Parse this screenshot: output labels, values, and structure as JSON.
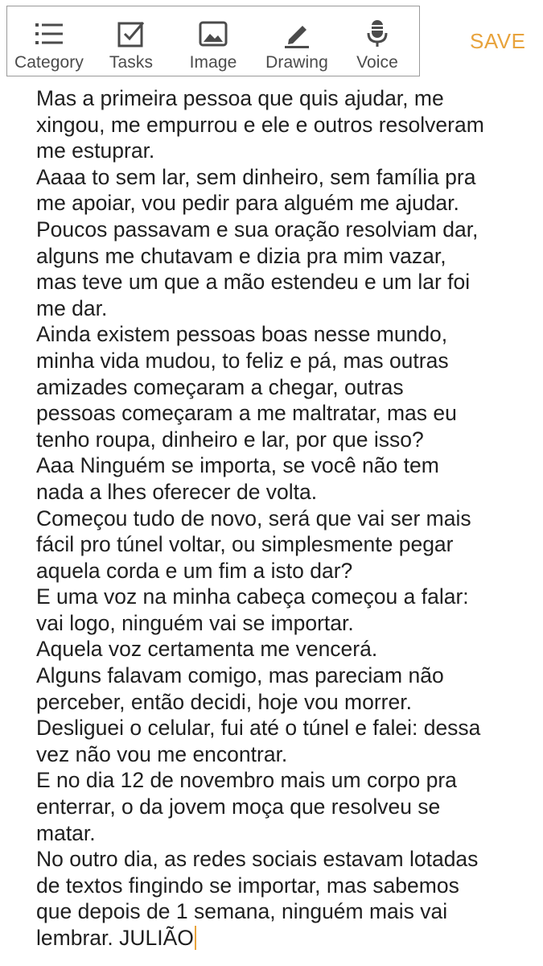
{
  "toolbar": {
    "items": [
      {
        "label": "Category",
        "icon": "list-icon"
      },
      {
        "label": "Tasks",
        "icon": "checkbox-icon"
      },
      {
        "label": "Image",
        "icon": "image-icon"
      },
      {
        "label": "Drawing",
        "icon": "pen-icon"
      },
      {
        "label": "Voice",
        "icon": "microphone-icon"
      }
    ],
    "save_label": "SAVE"
  },
  "colors": {
    "accent": "#e8a33c",
    "icon": "#4b4b4b",
    "text": "#1f1f1f",
    "border": "#9a9a9a"
  },
  "note": {
    "lines": [
      "Mas a primeira pessoa que quis ajudar, me",
      "xingou, me empurrou e ele e outros resolveram",
      "me estuprar.",
      "Aaaa to sem lar, sem dinheiro, sem família pra",
      "me apoiar, vou pedir para alguém me ajudar.",
      "Poucos passavam e sua oração resolviam dar,",
      "alguns me chutavam e dizia pra mim vazar,",
      "mas teve um que a mão estendeu e um lar foi",
      "me dar.",
      "Ainda existem pessoas boas nesse mundo,",
      "minha vida mudou, to feliz e pá, mas outras",
      "amizades começaram a chegar, outras",
      "pessoas começaram a me maltratar, mas eu",
      "tenho roupa, dinheiro e lar, por que isso?",
      "Aaa Ninguém se importa, se você não tem",
      "nada a lhes oferecer de volta.",
      "Começou tudo de novo, será que vai ser mais",
      "fácil pro túnel voltar, ou simplesmente pegar",
      "aquela corda e um fim a isto dar?",
      "E uma voz na minha cabeça começou a falar:",
      "vai logo, ninguém vai se importar.",
      "Aquela voz certamenta me vencerá.",
      "Alguns falavam comigo, mas pareciam não",
      "perceber, então decidi, hoje vou morrer.",
      "Desliguei o celular, fui até o túnel e falei: dessa",
      "vez não vou me encontrar.",
      "E no dia 12 de novembro mais um corpo pra",
      "enterrar, o da jovem moça que resolveu se",
      "matar.",
      "No outro dia, as redes sociais estavam lotadas",
      "de textos fingindo se importar, mas sabemos",
      "que depois de 1 semana, ninguém mais vai",
      "lembrar. JULIÃO"
    ]
  }
}
